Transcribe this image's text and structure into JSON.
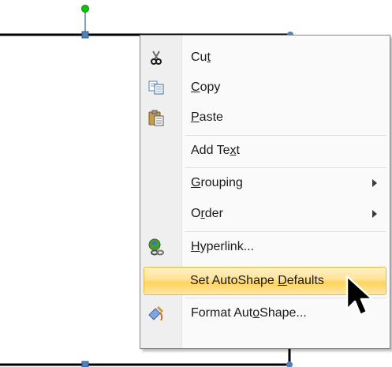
{
  "menu": {
    "items": [
      {
        "pre": "Cu",
        "key": "t",
        "post": "",
        "icon": "scissors-icon"
      },
      {
        "pre": "",
        "key": "C",
        "post": "opy",
        "icon": "copy-icon"
      },
      {
        "pre": "",
        "key": "P",
        "post": "aste",
        "icon": "paste-icon"
      },
      {
        "pre": "Add Te",
        "key": "x",
        "post": "t",
        "icon": ""
      },
      {
        "pre": "",
        "key": "G",
        "post": "rouping",
        "icon": "",
        "submenu": true
      },
      {
        "pre": "O",
        "key": "r",
        "post": "der",
        "icon": "",
        "submenu": true
      },
      {
        "pre": "",
        "key": "H",
        "post": "yperlink...",
        "icon": "hyperlink-icon"
      },
      {
        "pre": "Set AutoShape ",
        "key": "D",
        "post": "efaults",
        "icon": "",
        "highlighted": true
      },
      {
        "pre": "Format Aut",
        "key": "o",
        "post": "Shape...",
        "icon": "format-shape-icon"
      }
    ]
  },
  "colors": {
    "connector_line": "#000000",
    "handle_blue": "#4f81bd",
    "rotation_handle_green": "#00cc00",
    "highlight_border": "#e5b745"
  }
}
